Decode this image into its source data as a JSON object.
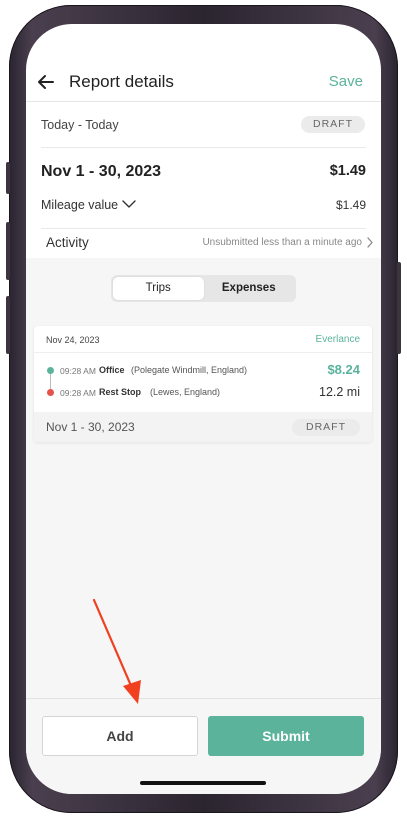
{
  "header": {
    "title": "Report details",
    "save_label": "Save"
  },
  "report": {
    "date_range_label": "Today - Today",
    "status": "DRAFT",
    "period": "Nov 1 - 30, 2023",
    "total": "$1.49",
    "mileage_label": "Mileage value",
    "mileage_value": "$1.49",
    "activity_label": "Activity",
    "activity_status": "Unsubmitted less than a minute ago"
  },
  "tabs": [
    {
      "label": "Trips",
      "active": true
    },
    {
      "label": "Expenses",
      "active": false
    }
  ],
  "trip": {
    "date": "Nov 24, 2023",
    "source": "Everlance",
    "amount": "$8.24",
    "distance": "12.2 mi",
    "stops": [
      {
        "time": "09:28 AM",
        "name": "Office",
        "detail": "(Polegate Windmill, England)"
      },
      {
        "time": "09:28 AM",
        "name": "Rest Stop",
        "detail": "(Lewes, England)"
      }
    ],
    "footer_period": "Nov 1 - 30, 2023",
    "footer_status": "DRAFT"
  },
  "actions": {
    "add_label": "Add",
    "submit_label": "Submit"
  },
  "colors": {
    "accent": "#5bb39c",
    "end_dot": "#e4524d",
    "annotation": "#f0401f"
  },
  "icons": {
    "back": "arrow-left-icon",
    "mileage_toggle": "chevron-down-icon",
    "activity": "chevron-right-icon"
  }
}
